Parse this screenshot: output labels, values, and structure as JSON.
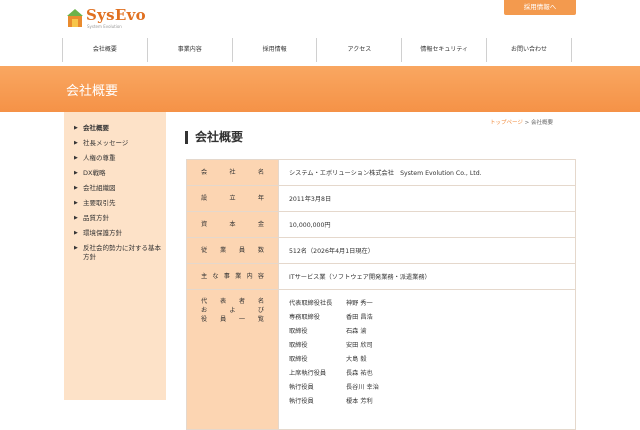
{
  "logo": {
    "text": "SysEvo",
    "subtext": "System Evolution"
  },
  "header": {
    "recruit_button": "採用情報へ"
  },
  "nav": [
    "会社概要",
    "事業内容",
    "採用情報",
    "アクセス",
    "情報セキュリティ",
    "お問い合わせ"
  ],
  "hero": {
    "title": "会社概要"
  },
  "sidebar": {
    "items": [
      "会社概要",
      "社長メッセージ",
      "人権の尊重",
      "DX戦略",
      "会社組織図",
      "主要取引先",
      "品質方針",
      "環境保護方針",
      "反社会的勢力に対する基本方針"
    ]
  },
  "breadcrumb": {
    "home": "トップページ",
    "separator": ">",
    "current": "会社概要"
  },
  "page_title": "会社概要",
  "table": {
    "rows": [
      {
        "label": [
          "会",
          "社",
          "名"
        ],
        "value": "システム・エボリューション株式会社　System Evolution Co., Ltd."
      },
      {
        "label": [
          "設",
          "立",
          "年"
        ],
        "value": "2011年3月8日"
      },
      {
        "label": [
          "資",
          "本",
          "金"
        ],
        "value": "10,000,000円"
      },
      {
        "label": [
          "従",
          "業",
          "員",
          "数"
        ],
        "value": "512名（2026年4月1日現在）"
      },
      {
        "label": [
          "主",
          "な",
          "事",
          "業",
          "内",
          "容"
        ],
        "value": "ITサービス業（ソフトウェア開発業務・派遣業務）"
      }
    ],
    "officers_label": [
      [
        "代",
        "表",
        "者",
        "名"
      ],
      [
        "お",
        "よ",
        "び"
      ],
      [
        "役",
        "員",
        "一",
        "覧"
      ]
    ],
    "officers": [
      {
        "title": "代表取締役社長",
        "name": "神野 秀一"
      },
      {
        "title": "専務取締役",
        "name": "香田 昌浩"
      },
      {
        "title": "取締役",
        "name": "石森 渝"
      },
      {
        "title": "取締役",
        "name": "安田 欣司"
      },
      {
        "title": "取締役",
        "name": "大島 毅"
      },
      {
        "title": "上席執行役員",
        "name": "長森 祐也"
      },
      {
        "title": "執行役員",
        "name": "長谷川 幸治"
      },
      {
        "title": "執行役員",
        "name": "榎本 芳利"
      }
    ]
  }
}
